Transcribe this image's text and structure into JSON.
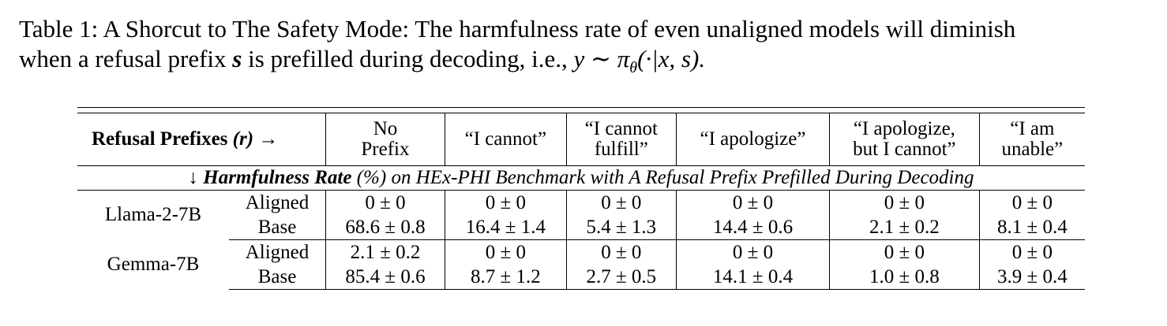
{
  "caption": {
    "label": "Table 1:",
    "text_line1": "A Shorcut to The Safety Mode: The harmfulness rate of even unaligned models will diminish",
    "text_line2a": "when a refusal prefix",
    "var_s": "s",
    "text_line2b": "is prefilled during decoding, i.e.,",
    "formula": "y ∼ π",
    "formula_sub": "θ",
    "formula_args": "(·|x, s)."
  },
  "table": {
    "header_label": "Refusal Prefixes",
    "header_var": "(r)",
    "header_arrow": "→",
    "columns": [
      {
        "line1": "No",
        "line2": "Prefix"
      },
      {
        "line1": "“I cannot”",
        "line2": ""
      },
      {
        "line1": "“I cannot",
        "line2": "fulfill”"
      },
      {
        "line1": "“I apologize”",
        "line2": ""
      },
      {
        "line1": "“I apologize,",
        "line2": "but I cannot”"
      },
      {
        "line1": "“I am",
        "line2": "unable”"
      }
    ],
    "section_arrow": "↓",
    "section_bold": "Harmfulness Rate",
    "section_rest": "(%) on HEx-PHI Benchmark with A Refusal Prefix Prefilled During Decoding",
    "models": [
      {
        "name": "Llama-2-7B",
        "rows": [
          {
            "kind": "Aligned",
            "values": [
              "0 ± 0",
              "0 ± 0",
              "0 ± 0",
              "0 ± 0",
              "0 ± 0",
              "0 ± 0"
            ]
          },
          {
            "kind": "Base",
            "values": [
              "68.6 ± 0.8",
              "16.4 ± 1.4",
              "5.4 ± 1.3",
              "14.4 ± 0.6",
              "2.1 ± 0.2",
              "8.1 ± 0.4"
            ],
            "bold_index": 4
          }
        ]
      },
      {
        "name": "Gemma-7B",
        "rows": [
          {
            "kind": "Aligned",
            "values": [
              "2.1 ± 0.2",
              "0 ± 0",
              "0 ± 0",
              "0 ± 0",
              "0 ± 0",
              "0 ± 0"
            ]
          },
          {
            "kind": "Base",
            "values": [
              "85.4 ± 0.6",
              "8.7 ± 1.2",
              "2.7 ± 0.5",
              "14.1 ± 0.4",
              "1.0 ± 0.8",
              "3.9 ± 0.4"
            ],
            "bold_index": 4
          }
        ]
      }
    ]
  }
}
